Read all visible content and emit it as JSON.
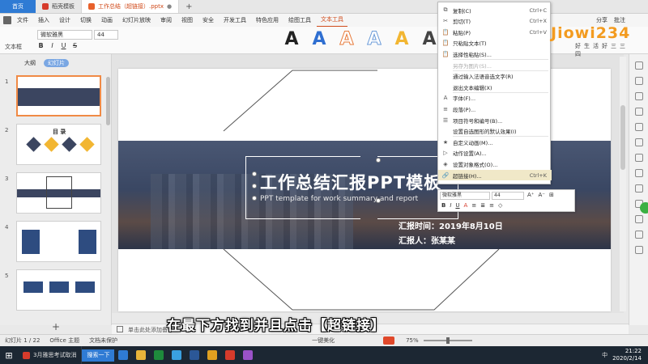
{
  "titlebar": {
    "home": "首页",
    "tabs": [
      {
        "label": "稻壳模板"
      },
      {
        "label": "工作总结（超链接）.pptx"
      }
    ]
  },
  "menubar": {
    "file": "文件",
    "items": [
      "插入",
      "设计",
      "切换",
      "动画",
      "幻灯片放映",
      "审阅",
      "视图",
      "安全",
      "开发工具",
      "特色应用",
      "绘图工具",
      "文本工具"
    ],
    "active_index": 11,
    "right_items": [
      "分享",
      "批注"
    ]
  },
  "ribbon": {
    "textbox_label": "文本框",
    "font": "微软雅黑",
    "size": "44",
    "format_buttons": [
      "B",
      "I",
      "U",
      "S"
    ],
    "art_letters": [
      "A",
      "A",
      "A",
      "A",
      "A",
      "A"
    ]
  },
  "leftpanel": {
    "tabs": [
      "大纲",
      "幻灯片"
    ],
    "slide_numbers": [
      "1",
      "2",
      "3",
      "4",
      "5"
    ],
    "thumb2_title": "目 录"
  },
  "slide": {
    "title": "工作总结汇报PPT模板",
    "subtitle": "PPT template for work summary and report",
    "date_line": "汇报时间：2019年8月10日",
    "reporter_line": "汇报人：张某某"
  },
  "context_menu": {
    "items": [
      {
        "icon": "copy-icon",
        "glyph": "⧉",
        "label": "复制(C)",
        "shortcut": "Ctrl+C",
        "disabled": false
      },
      {
        "icon": "cut-icon",
        "glyph": "✂",
        "label": "剪切(T)",
        "shortcut": "Ctrl+X",
        "disabled": false
      },
      {
        "icon": "paste-icon",
        "glyph": "📋",
        "label": "粘贴(P)",
        "shortcut": "Ctrl+V",
        "disabled": false
      },
      {
        "icon": "paste-text-icon",
        "glyph": "📋",
        "label": "只粘贴文本(T)",
        "shortcut": "",
        "disabled": false
      },
      {
        "icon": "paste-special-icon",
        "glyph": "📋",
        "label": "选择性粘贴(S)...",
        "shortcut": "",
        "disabled": false
      },
      {
        "icon": "save-image-icon",
        "glyph": "",
        "label": "另存为图片(S)...",
        "shortcut": "",
        "disabled": true
      },
      {
        "icon": "voice-input-icon",
        "glyph": "",
        "label": "通过输入法语音选文字(R)",
        "shortcut": "",
        "disabled": false
      },
      {
        "icon": "exit-edit-icon",
        "glyph": "",
        "label": "退出文本编辑(X)",
        "shortcut": "",
        "disabled": false
      },
      {
        "icon": "font-icon",
        "glyph": "A",
        "label": "字体(F)...",
        "shortcut": "",
        "disabled": false
      },
      {
        "icon": "paragraph-icon",
        "glyph": "≡",
        "label": "段落(P)...",
        "shortcut": "",
        "disabled": false
      },
      {
        "icon": "bullet-icon",
        "glyph": "☰",
        "label": "项目符号和编号(B)...",
        "shortcut": "",
        "disabled": false
      },
      {
        "icon": "default-effect-icon",
        "glyph": "",
        "label": "设置自选图形的默认效果(I)",
        "shortcut": "",
        "disabled": false
      },
      {
        "icon": "animation-icon",
        "glyph": "★",
        "label": "自定义动画(M)...",
        "shortcut": "",
        "disabled": false
      },
      {
        "icon": "action-icon",
        "glyph": "▷",
        "label": "动作设置(A)...",
        "shortcut": "",
        "disabled": false
      },
      {
        "icon": "object-format-icon",
        "glyph": "◈",
        "label": "设置对象格式(O)...",
        "shortcut": "",
        "disabled": false
      },
      {
        "icon": "hyperlink-icon",
        "glyph": "🔗",
        "label": "超链接(H)...",
        "shortcut": "Ctrl+K",
        "disabled": false
      }
    ],
    "highlighted_index": 15
  },
  "mini_toolbar": {
    "font": "微软雅黑",
    "size": "44",
    "row1": [
      "A⁺",
      "A⁻",
      "⊞"
    ],
    "row2": [
      "B",
      "I",
      "U",
      "A",
      "≡",
      "≣",
      "≡",
      "◇"
    ]
  },
  "logo": {
    "big": "Jiowi234",
    "small": "好生活好三三四"
  },
  "notes": {
    "placeholder": "单击此处添加备注"
  },
  "subtitle_overlay": "在最下方找到并且点击【超链接】",
  "status": {
    "slide_count": "幻灯片 1 / 22",
    "theme": "Office 主题",
    "protect": "文档未保护",
    "beautify": "一键美化",
    "zoom": "75%"
  },
  "taskbar": {
    "item1": "3月雅思考试取消",
    "search_button": "搜索一下",
    "clock_time": "21:22",
    "clock_date": "2020/2/14",
    "ime": "中"
  },
  "colors": {
    "accent": "#d04a1a",
    "home_blue": "#2f7bd4",
    "slide_band": "#3b4560",
    "logo_orange": "#f39b1f"
  }
}
